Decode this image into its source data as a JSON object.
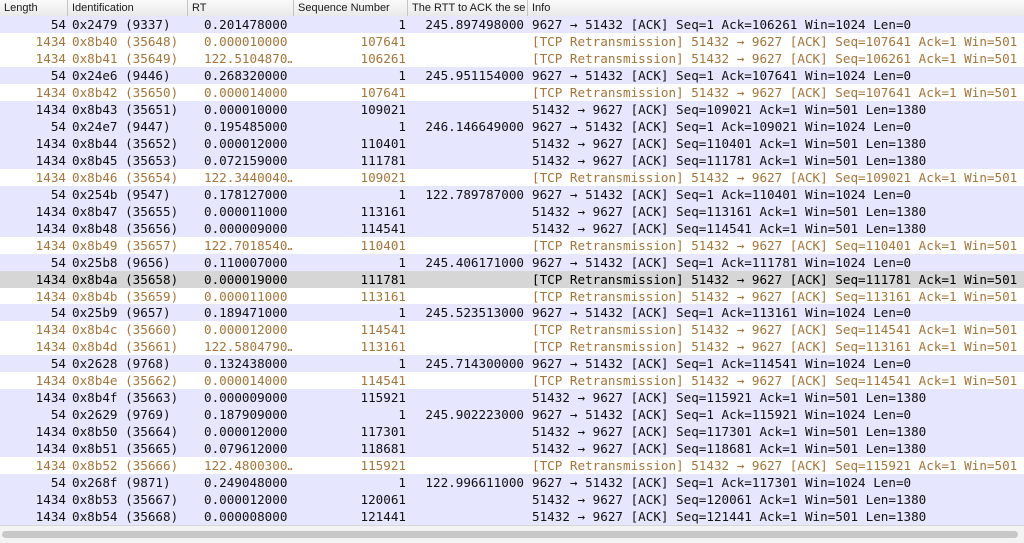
{
  "columns": {
    "length": "Length",
    "identification": "Identification",
    "rt": "RT",
    "seq": "Sequence Number",
    "rtt": "The RTT to ACK the se",
    "info": "Info"
  },
  "colors": {
    "normal_row": "#e7e6ff",
    "retransmission_row": "#ffffff",
    "retransmission_text": "#a6753a",
    "selected_row": "#d6d6d6"
  },
  "rows": [
    {
      "type": "normal",
      "length": "54",
      "id": "0x2479 (9337)",
      "rt": "0.201478000",
      "seq": "1",
      "rtt": "245.897498000",
      "info": "9627 → 51432 [ACK] Seq=1 Ack=106261 Win=1024 Len=0"
    },
    {
      "type": "retrans",
      "length": "1434",
      "id": "0x8b40 (35648)",
      "rt": "0.000010000",
      "seq": "107641",
      "rtt": "",
      "info": "[TCP Retransmission] 51432 → 9627 [ACK] Seq=107641 Ack=1 Win=501"
    },
    {
      "type": "retrans",
      "length": "1434",
      "id": "0x8b41 (35649)",
      "rt": "122.5104870…",
      "seq": "106261",
      "rtt": "",
      "info": "[TCP Retransmission] 51432 → 9627 [ACK] Seq=106261 Ack=1 Win=501"
    },
    {
      "type": "normal",
      "length": "54",
      "id": "0x24e6 (9446)",
      "rt": "0.268320000",
      "seq": "1",
      "rtt": "245.951154000",
      "info": "9627 → 51432 [ACK] Seq=1 Ack=107641 Win=1024 Len=0"
    },
    {
      "type": "retrans",
      "length": "1434",
      "id": "0x8b42 (35650)",
      "rt": "0.000014000",
      "seq": "107641",
      "rtt": "",
      "info": "[TCP Retransmission] 51432 → 9627 [ACK] Seq=107641 Ack=1 Win=501"
    },
    {
      "type": "normal",
      "length": "1434",
      "id": "0x8b43 (35651)",
      "rt": "0.000010000",
      "seq": "109021",
      "rtt": "",
      "info": "51432 → 9627 [ACK] Seq=109021 Ack=1 Win=501 Len=1380"
    },
    {
      "type": "normal",
      "length": "54",
      "id": "0x24e7 (9447)",
      "rt": "0.195485000",
      "seq": "1",
      "rtt": "246.146649000",
      "info": "9627 → 51432 [ACK] Seq=1 Ack=109021 Win=1024 Len=0"
    },
    {
      "type": "normal",
      "length": "1434",
      "id": "0x8b44 (35652)",
      "rt": "0.000012000",
      "seq": "110401",
      "rtt": "",
      "info": "51432 → 9627 [ACK] Seq=110401 Ack=1 Win=501 Len=1380"
    },
    {
      "type": "normal",
      "length": "1434",
      "id": "0x8b45 (35653)",
      "rt": "0.072159000",
      "seq": "111781",
      "rtt": "",
      "info": "51432 → 9627 [ACK] Seq=111781 Ack=1 Win=501 Len=1380"
    },
    {
      "type": "retrans",
      "length": "1434",
      "id": "0x8b46 (35654)",
      "rt": "122.3440040…",
      "seq": "109021",
      "rtt": "",
      "info": "[TCP Retransmission] 51432 → 9627 [ACK] Seq=109021 Ack=1 Win=501"
    },
    {
      "type": "normal",
      "length": "54",
      "id": "0x254b (9547)",
      "rt": "0.178127000",
      "seq": "1",
      "rtt": "122.789787000",
      "info": "9627 → 51432 [ACK] Seq=1 Ack=110401 Win=1024 Len=0"
    },
    {
      "type": "normal",
      "length": "1434",
      "id": "0x8b47 (35655)",
      "rt": "0.000011000",
      "seq": "113161",
      "rtt": "",
      "info": "51432 → 9627 [ACK] Seq=113161 Ack=1 Win=501 Len=1380"
    },
    {
      "type": "normal",
      "length": "1434",
      "id": "0x8b48 (35656)",
      "rt": "0.000009000",
      "seq": "114541",
      "rtt": "",
      "info": "51432 → 9627 [ACK] Seq=114541 Ack=1 Win=501 Len=1380"
    },
    {
      "type": "retrans",
      "length": "1434",
      "id": "0x8b49 (35657)",
      "rt": "122.7018540…",
      "seq": "110401",
      "rtt": "",
      "info": "[TCP Retransmission] 51432 → 9627 [ACK] Seq=110401 Ack=1 Win=501"
    },
    {
      "type": "normal",
      "length": "54",
      "id": "0x25b8 (9656)",
      "rt": "0.110007000",
      "seq": "1",
      "rtt": "245.406171000",
      "info": "9627 → 51432 [ACK] Seq=1 Ack=111781 Win=1024 Len=0"
    },
    {
      "type": "selected",
      "length": "1434",
      "id": "0x8b4a (35658)",
      "rt": "0.000019000",
      "seq": "111781",
      "rtt": "",
      "info": "[TCP Retransmission] 51432 → 9627 [ACK] Seq=111781 Ack=1 Win=501"
    },
    {
      "type": "retrans",
      "length": "1434",
      "id": "0x8b4b (35659)",
      "rt": "0.000011000",
      "seq": "113161",
      "rtt": "",
      "info": "[TCP Retransmission] 51432 → 9627 [ACK] Seq=113161 Ack=1 Win=501"
    },
    {
      "type": "normal",
      "length": "54",
      "id": "0x25b9 (9657)",
      "rt": "0.189471000",
      "seq": "1",
      "rtt": "245.523513000",
      "info": "9627 → 51432 [ACK] Seq=1 Ack=113161 Win=1024 Len=0"
    },
    {
      "type": "retrans",
      "length": "1434",
      "id": "0x8b4c (35660)",
      "rt": "0.000012000",
      "seq": "114541",
      "rtt": "",
      "info": "[TCP Retransmission] 51432 → 9627 [ACK] Seq=114541 Ack=1 Win=501"
    },
    {
      "type": "retrans",
      "length": "1434",
      "id": "0x8b4d (35661)",
      "rt": "122.5804790…",
      "seq": "113161",
      "rtt": "",
      "info": "[TCP Retransmission] 51432 → 9627 [ACK] Seq=113161 Ack=1 Win=501"
    },
    {
      "type": "normal",
      "length": "54",
      "id": "0x2628 (9768)",
      "rt": "0.132438000",
      "seq": "1",
      "rtt": "245.714300000",
      "info": "9627 → 51432 [ACK] Seq=1 Ack=114541 Win=1024 Len=0"
    },
    {
      "type": "retrans",
      "length": "1434",
      "id": "0x8b4e (35662)",
      "rt": "0.000014000",
      "seq": "114541",
      "rtt": "",
      "info": "[TCP Retransmission] 51432 → 9627 [ACK] Seq=114541 Ack=1 Win=501"
    },
    {
      "type": "normal",
      "length": "1434",
      "id": "0x8b4f (35663)",
      "rt": "0.000009000",
      "seq": "115921",
      "rtt": "",
      "info": "51432 → 9627 [ACK] Seq=115921 Ack=1 Win=501 Len=1380"
    },
    {
      "type": "normal",
      "length": "54",
      "id": "0x2629 (9769)",
      "rt": "0.187909000",
      "seq": "1",
      "rtt": "245.902223000",
      "info": "9627 → 51432 [ACK] Seq=1 Ack=115921 Win=1024 Len=0"
    },
    {
      "type": "normal",
      "length": "1434",
      "id": "0x8b50 (35664)",
      "rt": "0.000012000",
      "seq": "117301",
      "rtt": "",
      "info": "51432 → 9627 [ACK] Seq=117301 Ack=1 Win=501 Len=1380"
    },
    {
      "type": "normal",
      "length": "1434",
      "id": "0x8b51 (35665)",
      "rt": "0.079612000",
      "seq": "118681",
      "rtt": "",
      "info": "51432 → 9627 [ACK] Seq=118681 Ack=1 Win=501 Len=1380"
    },
    {
      "type": "retrans",
      "length": "1434",
      "id": "0x8b52 (35666)",
      "rt": "122.4800300…",
      "seq": "115921",
      "rtt": "",
      "info": "[TCP Retransmission] 51432 → 9627 [ACK] Seq=115921 Ack=1 Win=501"
    },
    {
      "type": "normal",
      "length": "54",
      "id": "0x268f (9871)",
      "rt": "0.249048000",
      "seq": "1",
      "rtt": "122.996611000",
      "info": "9627 → 51432 [ACK] Seq=1 Ack=117301 Win=1024 Len=0"
    },
    {
      "type": "normal",
      "length": "1434",
      "id": "0x8b53 (35667)",
      "rt": "0.000012000",
      "seq": "120061",
      "rtt": "",
      "info": "51432 → 9627 [ACK] Seq=120061 Ack=1 Win=501 Len=1380"
    },
    {
      "type": "normal",
      "length": "1434",
      "id": "0x8b54 (35668)",
      "rt": "0.000008000",
      "seq": "121441",
      "rtt": "",
      "info": "51432 → 9627 [ACK] Seq=121441 Ack=1 Win=501 Len=1380"
    }
  ]
}
